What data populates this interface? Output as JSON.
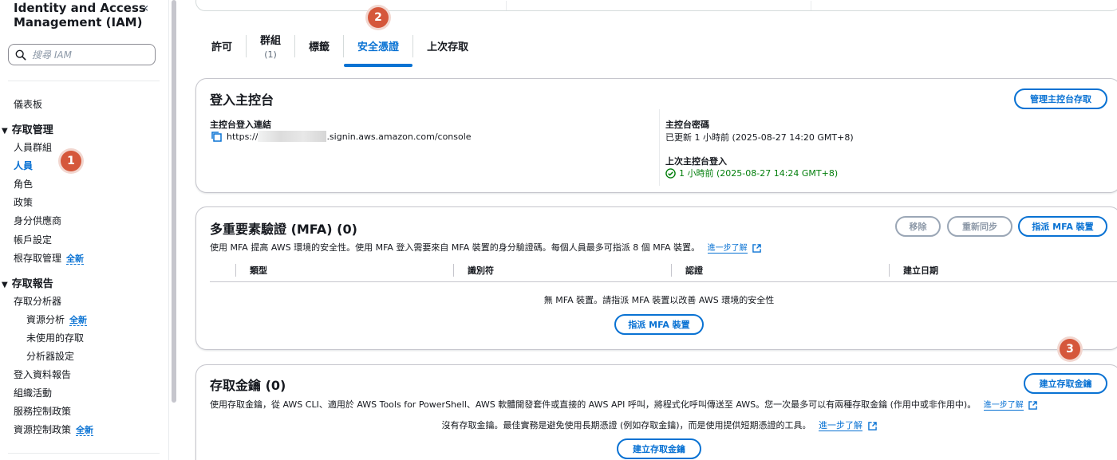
{
  "sidebar": {
    "title": "Identity and Access Management (IAM)",
    "search_placeholder": "搜尋 IAM",
    "dashboard": "儀表板",
    "access_management": {
      "label": "存取管理",
      "items": [
        {
          "label": "人員群組"
        },
        {
          "label": "人員"
        },
        {
          "label": "角色"
        },
        {
          "label": "政策"
        },
        {
          "label": "身分供應商"
        },
        {
          "label": "帳戶設定"
        },
        {
          "label": "根存取管理",
          "badge": "全新"
        }
      ]
    },
    "access_reports": {
      "label": "存取報告",
      "items": [
        {
          "label": "存取分析器"
        },
        {
          "label": "資源分析",
          "badge": "全新"
        },
        {
          "label": "未使用的存取"
        },
        {
          "label": "分析器設定"
        },
        {
          "label": "登入資料報告"
        },
        {
          "label": "組織活動"
        },
        {
          "label": "服務控制政策"
        },
        {
          "label": "資源控制政策",
          "badge": "全新"
        }
      ]
    }
  },
  "tabs": [
    {
      "label": "許可"
    },
    {
      "label": "群組",
      "sub": "(1)"
    },
    {
      "label": "標籤"
    },
    {
      "label": "安全憑證",
      "active": true
    },
    {
      "label": "上次存取"
    }
  ],
  "callouts": [
    "1",
    "2",
    "3"
  ],
  "console_signin": {
    "title": "登入主控台",
    "manage_button": "管理主控台存取",
    "signin_link_label": "主控台登入連結",
    "signin_link_prefix": "https://",
    "signin_link_suffix": ".signin.aws.amazon.com/console",
    "password_label": "主控台密碼",
    "password_value": "已更新 1 小時前 (2025-08-27 14:20 GMT+8)",
    "last_signin_label": "上次主控台登入",
    "last_signin_value": "1 小時前 (2025-08-27 14:24 GMT+8)"
  },
  "mfa": {
    "title": "多重要素驗證 (MFA) (0)",
    "remove_button": "移除",
    "resync_button": "重新同步",
    "assign_button": "指派 MFA 裝置",
    "description": "使用 MFA 提高 AWS 環境的安全性。使用 MFA 登入需要來自 MFA 裝置的身分驗證碼。每個人員最多可指派 8 個 MFA 裝置。",
    "learn_more": "進一步了解",
    "columns": [
      "類型",
      "識別符",
      "認證",
      "建立日期"
    ],
    "empty_text": "無 MFA 裝置。請指派 MFA 裝置以改善 AWS 環境的安全性",
    "empty_button": "指派 MFA 裝置"
  },
  "access_keys": {
    "title": "存取金鑰 (0)",
    "create_button": "建立存取金鑰",
    "description": "使用存取金鑰，從 AWS CLI、適用於 AWS Tools for PowerShell、AWS 軟體開發套件或直接的 AWS API 呼叫，將程式化呼叫傳送至 AWS。您一次最多可以有兩種存取金鑰 (作用中或非作用中)。",
    "learn_more": "進一步了解",
    "empty_text": "沒有存取金鑰。最佳實務是避免使用長期憑證 (例如存取金鑰)，而是使用提供短期憑證的工具。",
    "empty_learn_more": "進一步了解",
    "empty_button": "建立存取金鑰"
  }
}
